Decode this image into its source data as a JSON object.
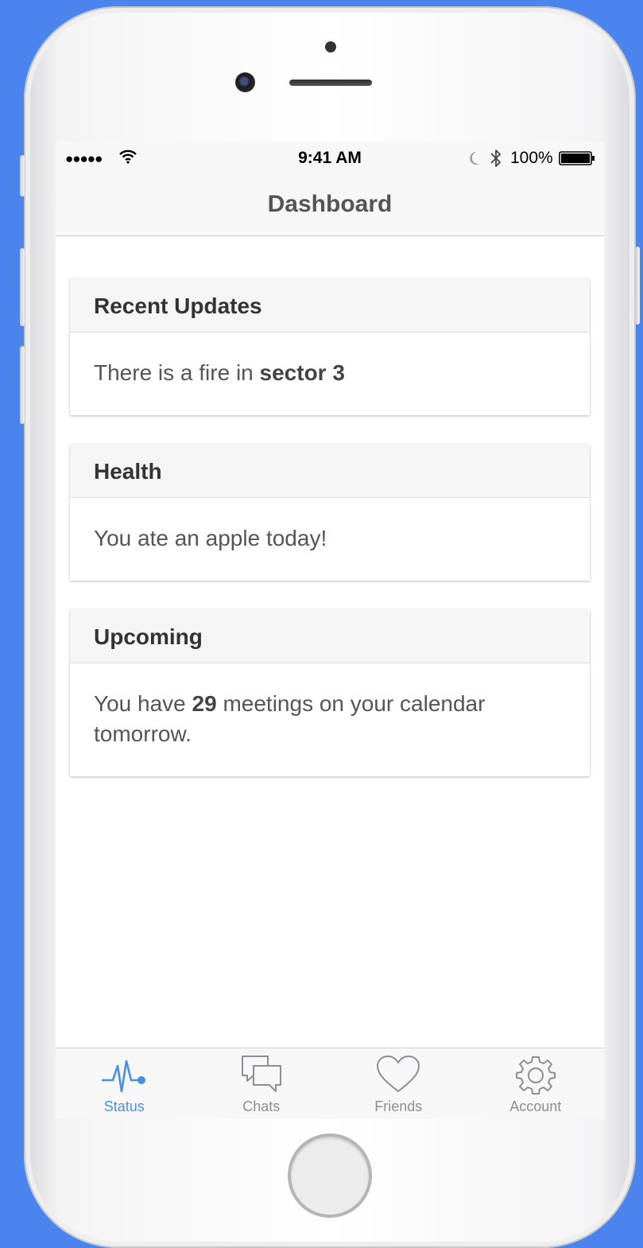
{
  "status_bar": {
    "time": "9:41 AM",
    "battery_percent": "100%",
    "signal_dots": "●●●●●"
  },
  "nav": {
    "title": "Dashboard"
  },
  "cards": [
    {
      "title": "Recent Updates",
      "body_prefix": "There is a fire in ",
      "body_bold": "sector 3",
      "body_suffix": ""
    },
    {
      "title": "Health",
      "body_prefix": "You ate an apple today!",
      "body_bold": "",
      "body_suffix": ""
    },
    {
      "title": "Upcoming",
      "body_prefix": "You have ",
      "body_bold": "29",
      "body_suffix": " meetings on your calendar tomorrow."
    }
  ],
  "tabs": [
    {
      "label": "Status",
      "icon": "pulse-icon",
      "active": true
    },
    {
      "label": "Chats",
      "icon": "chat-bubbles-icon",
      "active": false
    },
    {
      "label": "Friends",
      "icon": "heart-icon",
      "active": false
    },
    {
      "label": "Account",
      "icon": "gear-icon",
      "active": false
    }
  ],
  "colors": {
    "background": "#4a84ec",
    "accent": "#4a90e2",
    "inactive_tab": "#8e8e93"
  }
}
